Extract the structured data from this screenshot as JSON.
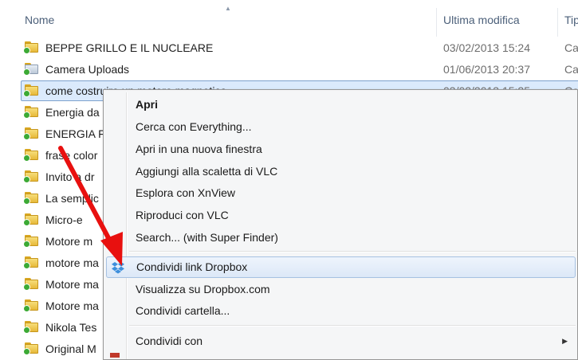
{
  "header": {
    "col_name": "Nome",
    "col_date": "Ultima modifica",
    "col_type": "Tip"
  },
  "files": [
    {
      "name": "BEPPE GRILLO E IL NUCLEARE",
      "date": "03/02/2013 15:24",
      "type": "Ca"
    },
    {
      "name": "Camera Uploads",
      "date": "01/06/2013 20:37",
      "type": "Ca"
    },
    {
      "name": "come costruire un motore magnetico",
      "date": "03/02/2013 15:25",
      "type": "Ca"
    },
    {
      "name": "Energia da",
      "date": "",
      "type": ""
    },
    {
      "name": "ENERGIA F",
      "date": "",
      "type": ""
    },
    {
      "name": "frase color",
      "date": "",
      "type": ""
    },
    {
      "name": "Invito a dr",
      "date": "",
      "type": ""
    },
    {
      "name": "La semplic",
      "date": "",
      "type": ""
    },
    {
      "name": "Micro-e",
      "date": "",
      "type": ""
    },
    {
      "name": "Motore m",
      "date": "",
      "type": ""
    },
    {
      "name": "motore ma",
      "date": "",
      "type": ""
    },
    {
      "name": "Motore ma",
      "date": "",
      "type": ""
    },
    {
      "name": "Motore ma",
      "date": "",
      "type": ""
    },
    {
      "name": "Nikola Tes",
      "date": "",
      "type": ""
    },
    {
      "name": "Original M",
      "date": "",
      "type": ""
    }
  ],
  "context_menu": {
    "items": [
      {
        "label": "Apri"
      },
      {
        "label": "Cerca con Everything..."
      },
      {
        "label": "Apri in una nuova finestra"
      },
      {
        "label": "Aggiungi alla scaletta di VLC"
      },
      {
        "label": "Esplora con XnView"
      },
      {
        "label": "Riproduci con VLC"
      },
      {
        "label": "Search... (with Super Finder)"
      },
      {
        "label": "Condividi link Dropbox"
      },
      {
        "label": "Visualizza su Dropbox.com"
      },
      {
        "label": "Condividi cartella..."
      },
      {
        "label": "Condividi con"
      }
    ]
  },
  "colors": {
    "selection_bg": "#dbeafc",
    "selection_border": "#7da2ce",
    "arrow": "#e8100f",
    "menu_bg": "#f5f6f7",
    "dropbox_blue": "#3d8fdc"
  },
  "icons": {
    "folder": "folder-icon",
    "sync": "dropbox-synced-badge-icon",
    "dropbox": "dropbox-icon",
    "submenu": "chevron-right-icon"
  }
}
